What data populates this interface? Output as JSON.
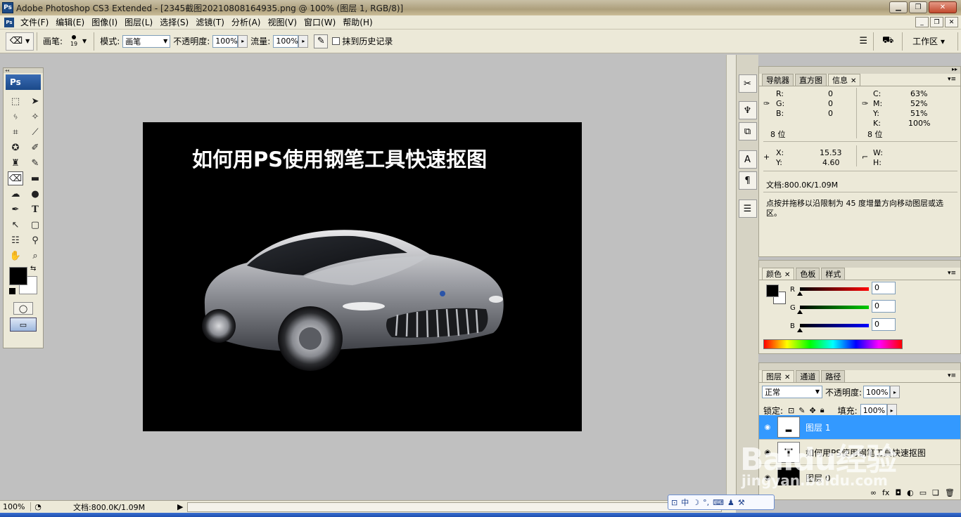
{
  "window": {
    "title": "Adobe Photoshop CS3 Extended - [2345截图20210808164935.png @ 100% (图层 1, RGB/8)]",
    "app_badge": "Ps",
    "min_btn": "▁",
    "max_btn": "❐",
    "close_btn": "✕"
  },
  "menu": {
    "items": [
      "文件(F)",
      "编辑(E)",
      "图像(I)",
      "图层(L)",
      "选择(S)",
      "滤镜(T)",
      "分析(A)",
      "视图(V)",
      "窗口(W)",
      "帮助(H)"
    ],
    "doc_min": "_",
    "doc_restore": "❐",
    "doc_close": "✕"
  },
  "options": {
    "brush_label": "画笔:",
    "brush_size": "19",
    "mode_label": "模式:",
    "mode_value": "画笔",
    "opacity_label": "不透明度:",
    "opacity_value": "100%",
    "flow_label": "流量:",
    "flow_value": "100%",
    "history_label": "抹到历史记录",
    "workspace_label": "工作区 ▾"
  },
  "canvas": {
    "title_text": "如何用PS使用钢笔工具快速抠图"
  },
  "toolbox": {
    "logo": "Ps"
  },
  "info_panel": {
    "tabs": [
      "导航器",
      "直方图",
      "信息"
    ],
    "rgb": {
      "R": "0",
      "G": "0",
      "B": "0"
    },
    "cmyk": {
      "C": "63%",
      "M": "52%",
      "Y": "51%",
      "K": "100%"
    },
    "bit_left": "8 位",
    "bit_right": "8 位",
    "x_label": "X:",
    "x_value": "15.53",
    "y_label": "Y:",
    "y_value": "4.60",
    "w_label": "W:",
    "h_label": "H:",
    "doc_size": "文档:800.0K/1.09M",
    "hint": "点按并拖移以沿限制为 45 度增量方向移动图层或选区。"
  },
  "color_panel": {
    "tabs": [
      "颜色",
      "色板",
      "样式"
    ],
    "r_label": "R",
    "g_label": "G",
    "b_label": "B",
    "r_value": "0",
    "g_value": "0",
    "b_value": "0"
  },
  "layers_panel": {
    "tabs": [
      "图层",
      "通道",
      "路径"
    ],
    "blend_mode": "正常",
    "opacity_label": "不透明度:",
    "opacity_value": "100%",
    "lock_label": "锁定:",
    "fill_label": "填充:",
    "fill_value": "100%",
    "layers": [
      {
        "name": "图层 1",
        "thumb": ""
      },
      {
        "name": "如何用PS使用钢笔工具快速抠图",
        "thumb": "T"
      },
      {
        "name": "图层 0",
        "thumb": ""
      }
    ]
  },
  "status": {
    "zoom": "100%",
    "doc_size": "文档:800.0K/1.09M"
  },
  "ime": {
    "lang": "中"
  },
  "watermark": {
    "main": "Baidu经验",
    "sub": "jingyan.baidu.com"
  },
  "colors": {
    "accent": "#3399ff",
    "panel_bg": "#ece9d8",
    "canvas_bg": "#c0c0c0"
  }
}
